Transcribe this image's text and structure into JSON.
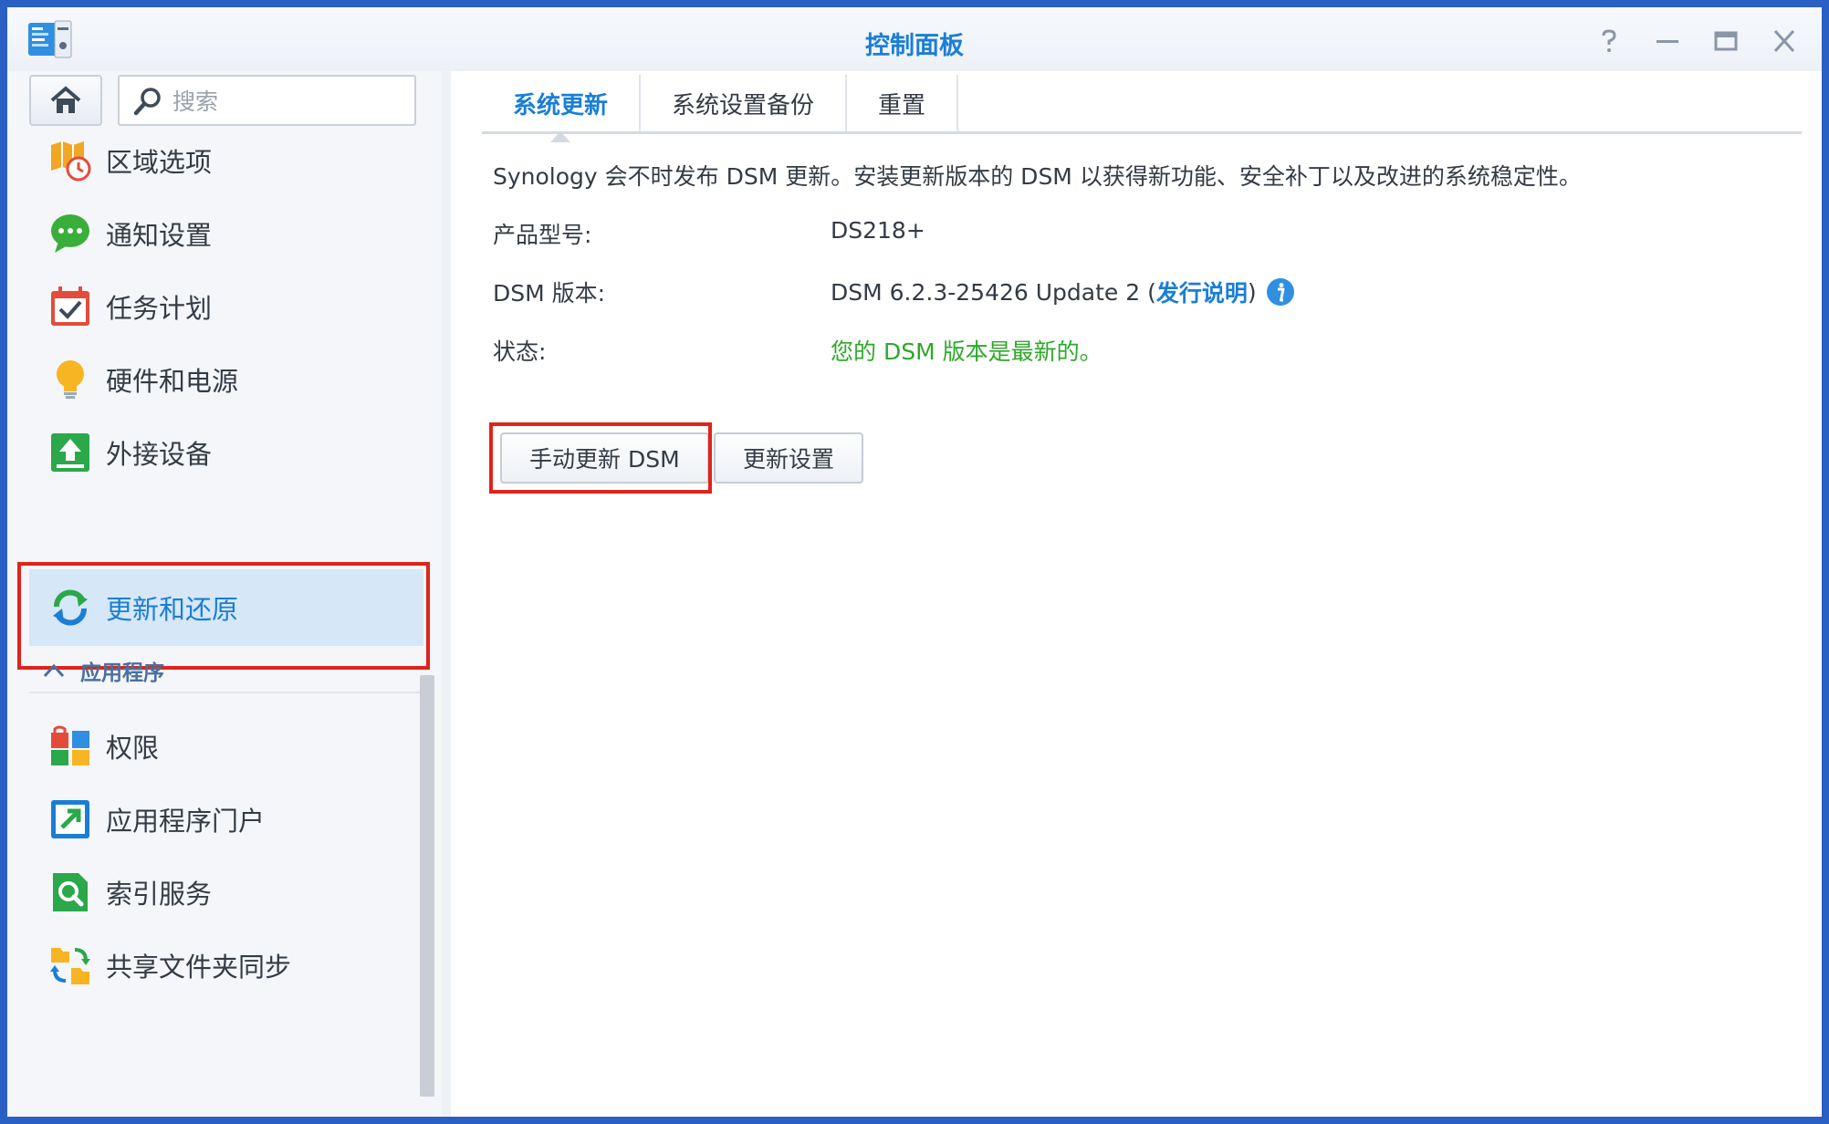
{
  "window": {
    "title": "控制面板",
    "controls": [
      "help-icon",
      "minimize-icon",
      "maximize-icon",
      "close-icon"
    ]
  },
  "sidebar": {
    "search_placeholder": "搜索",
    "items": [
      {
        "label": "区域选项",
        "icon": "region-options-icon"
      },
      {
        "label": "通知设置",
        "icon": "notification-icon"
      },
      {
        "label": "任务计划",
        "icon": "task-scheduler-icon"
      },
      {
        "label": "硬件和电源",
        "icon": "lightbulb-icon"
      },
      {
        "label": "外接设备",
        "icon": "external-device-icon"
      },
      {
        "label": "更新和还原",
        "icon": "update-restore-icon",
        "selected": true
      }
    ],
    "section": {
      "label": "应用程序"
    },
    "app_items": [
      {
        "label": "权限",
        "icon": "privileges-icon"
      },
      {
        "label": "应用程序门户",
        "icon": "application-portal-icon"
      },
      {
        "label": "索引服务",
        "icon": "indexing-service-icon"
      },
      {
        "label": "共享文件夹同步",
        "icon": "shared-folder-sync-icon"
      }
    ]
  },
  "main": {
    "tabs": [
      {
        "label": "系统更新",
        "active": true
      },
      {
        "label": "系统设置备份"
      },
      {
        "label": "重置"
      }
    ],
    "description": "Synology 会不时发布 DSM 更新。安装更新版本的 DSM 以获得新功能、安全补丁以及改进的系统稳定性。",
    "model": {
      "label": "产品型号:",
      "value": "DS218+"
    },
    "version": {
      "label": "DSM 版本:",
      "value": "DSM 6.2.3-25426 Update 2 (",
      "link": "发行说明",
      "suffix": ")"
    },
    "status": {
      "label": "状态:",
      "value": "您的 DSM 版本是最新的。"
    },
    "buttons": {
      "manual_update": "手动更新 DSM",
      "update_settings": "更新设置"
    }
  },
  "colors": {
    "accent": "#1a7ed6",
    "status_ok": "#2ea829",
    "highlight": "#e0231b",
    "selected_bg": "#d6e7f7"
  }
}
